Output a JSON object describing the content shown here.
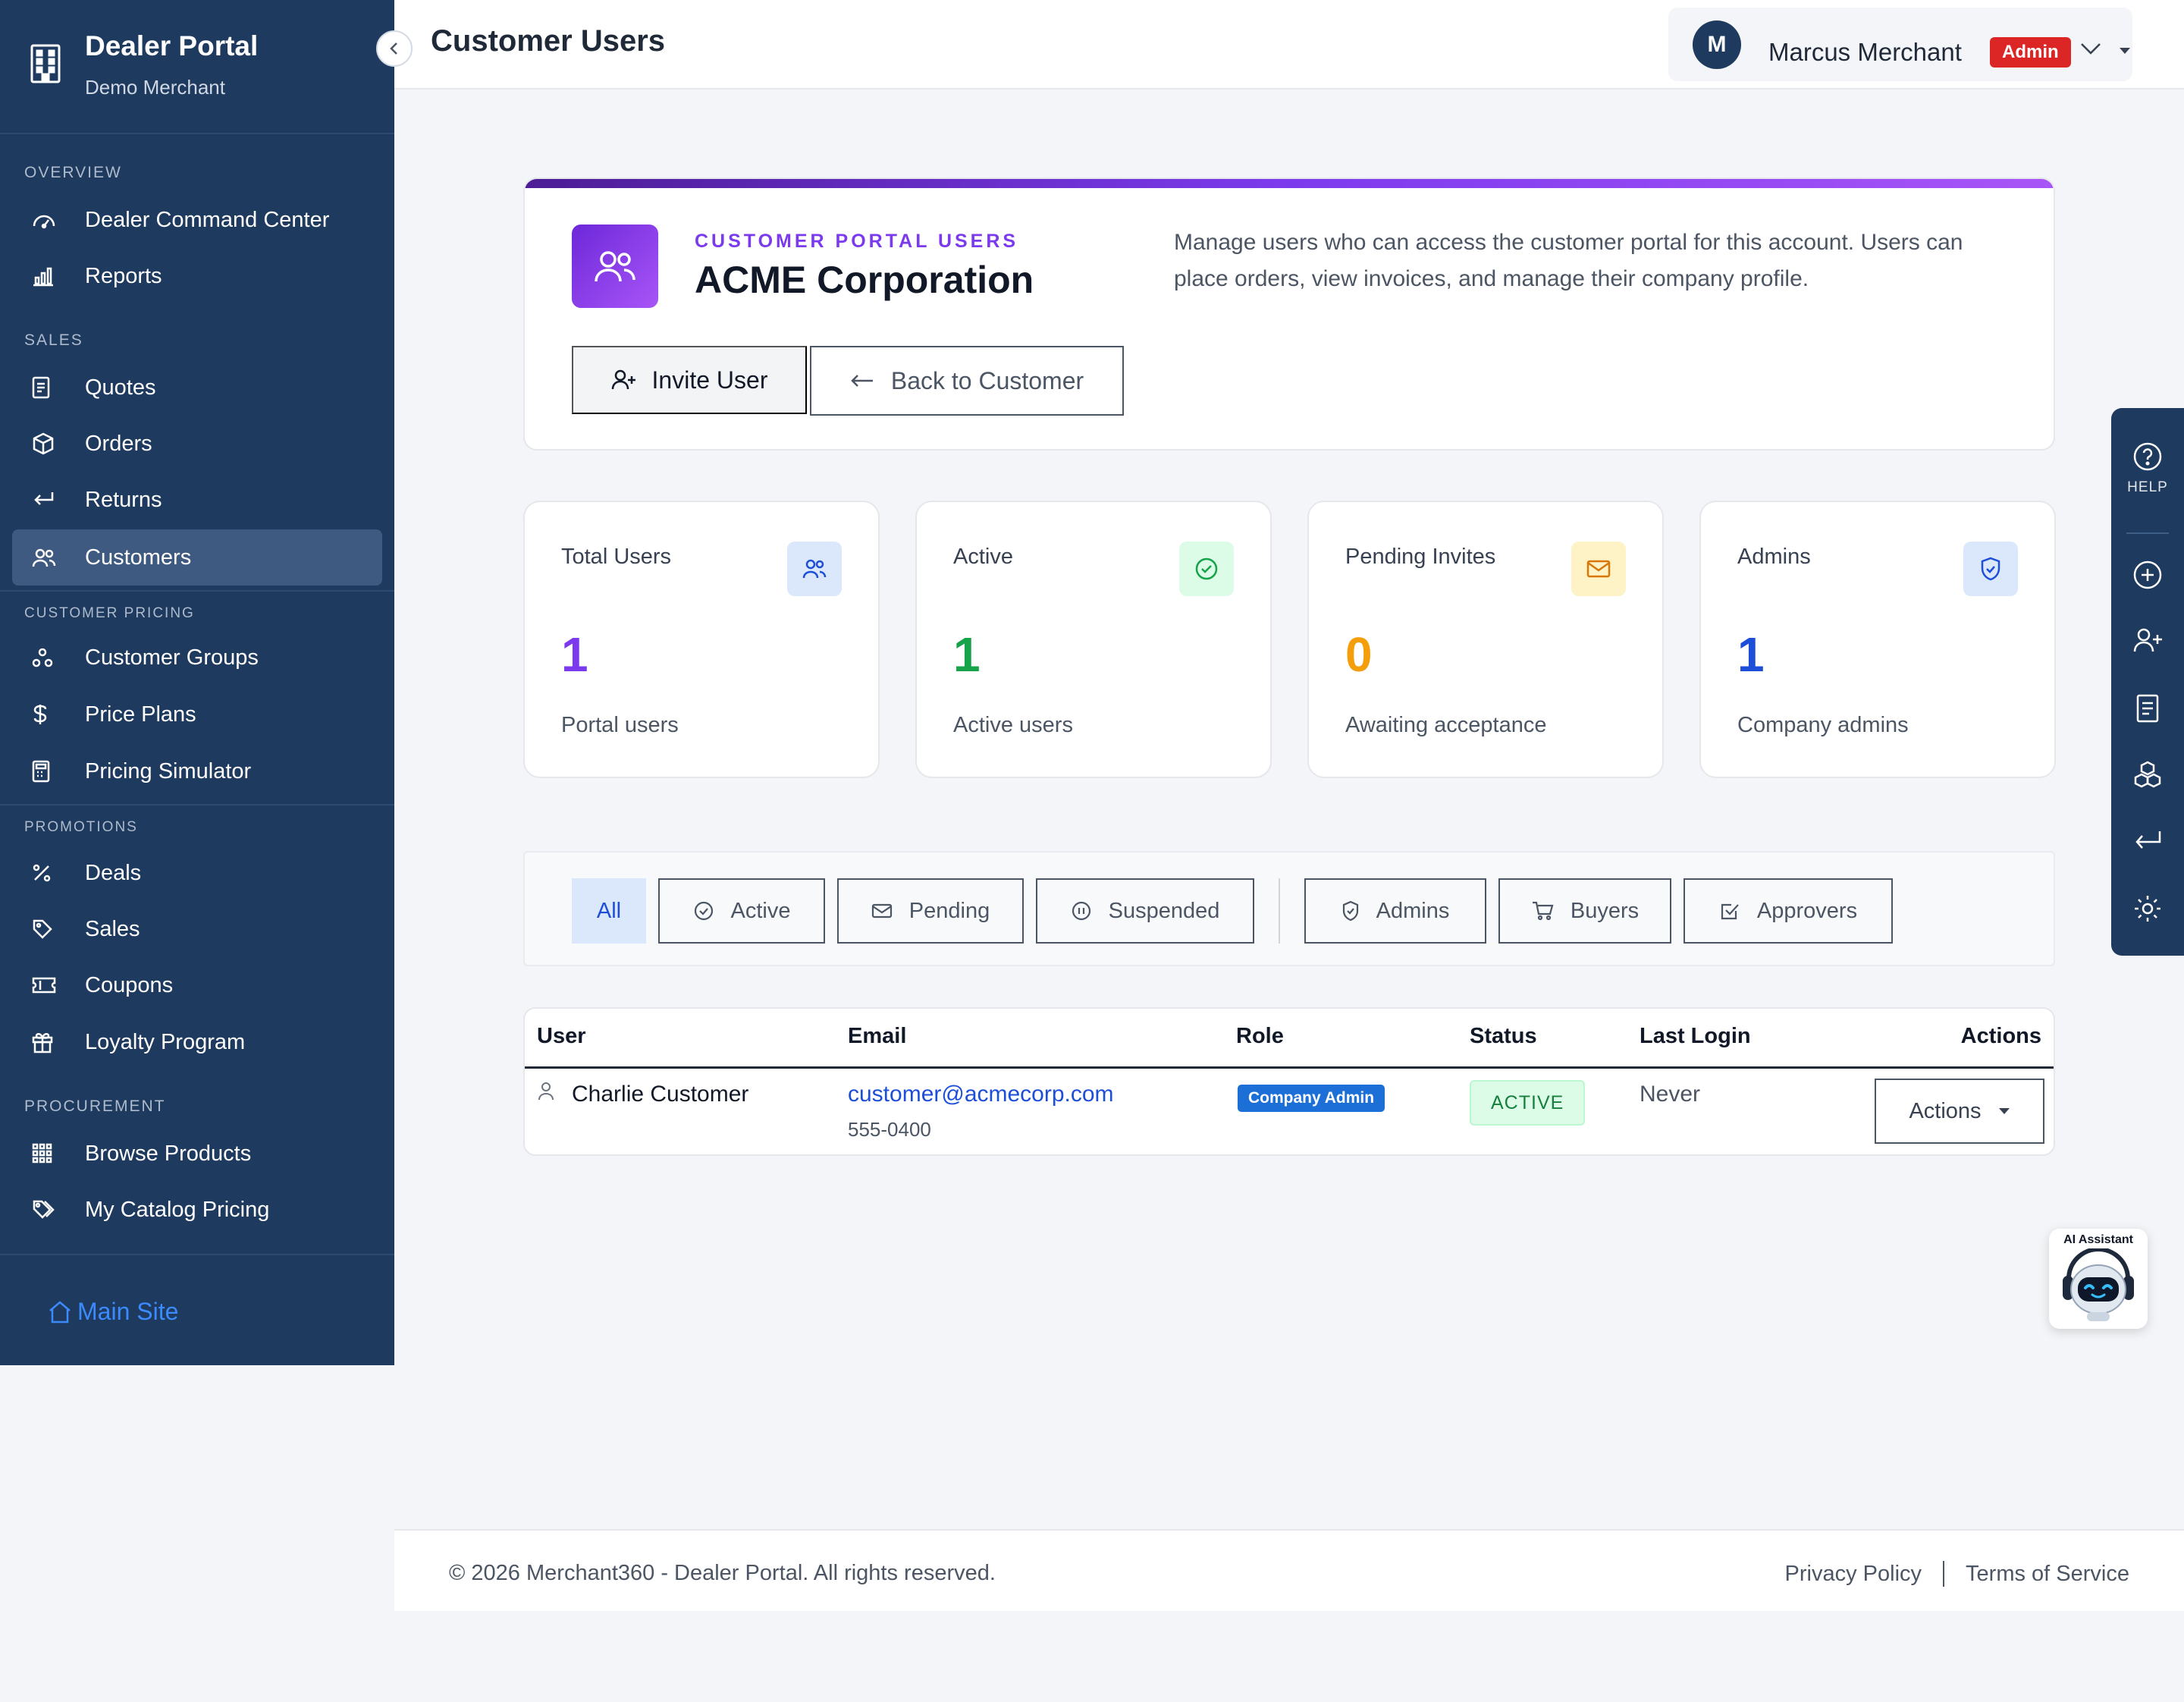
{
  "sidebar": {
    "brand_title": "Dealer Portal",
    "brand_subtitle": "Demo Merchant",
    "sections": {
      "overview": "OVERVIEW",
      "sales": "SALES",
      "customer_pricing": "CUSTOMER PRICING",
      "promotions": "PROMOTIONS",
      "procurement": "PROCUREMENT"
    },
    "items": {
      "command_center": "Dealer Command Center",
      "reports": "Reports",
      "quotes": "Quotes",
      "orders": "Orders",
      "returns": "Returns",
      "customers": "Customers",
      "customer_groups": "Customer Groups",
      "price_plans": "Price Plans",
      "pricing_simulator": "Pricing Simulator",
      "deals": "Deals",
      "sales": "Sales",
      "coupons": "Coupons",
      "loyalty": "Loyalty Program",
      "browse_products": "Browse Products",
      "catalog_pricing": "My Catalog Pricing"
    },
    "active_item": "Customers",
    "main_site": "Main Site"
  },
  "header": {
    "title": "Customer Users",
    "user_initial": "M",
    "user_name": "Marcus Merchant",
    "user_role": "Admin"
  },
  "hero": {
    "eyebrow": "CUSTOMER PORTAL USERS",
    "title": "ACME Corporation",
    "description": "Manage users who can access the customer portal for this account. Users can place orders, view invoices, and manage their company profile.",
    "invite_label": "Invite User",
    "back_label": "Back to Customer"
  },
  "stats": [
    {
      "label": "Total Users",
      "value": "1",
      "sub": "Portal users",
      "color": "#7c3aed",
      "icon": "users-icon"
    },
    {
      "label": "Active",
      "value": "1",
      "sub": "Active users",
      "color": "#16a34a",
      "icon": "check-circle-icon"
    },
    {
      "label": "Pending Invites",
      "value": "0",
      "sub": "Awaiting acceptance",
      "color": "#f59e0b",
      "icon": "envelope-icon"
    },
    {
      "label": "Admins",
      "value": "1",
      "sub": "Company admins",
      "color": "#1d4ed8",
      "icon": "shield-icon"
    }
  ],
  "filters": {
    "all": "All",
    "active": "Active",
    "pending": "Pending",
    "suspended": "Suspended",
    "admins": "Admins",
    "buyers": "Buyers",
    "approvers": "Approvers",
    "selected": "All"
  },
  "table": {
    "headers": {
      "user": "User",
      "email": "Email",
      "role": "Role",
      "status": "Status",
      "last_login": "Last Login",
      "actions": "Actions"
    },
    "rows": [
      {
        "user": "Charlie Customer",
        "email": "customer@acmecorp.com",
        "phone": "555-0400",
        "role": "Company Admin",
        "status": "ACTIVE",
        "last_login": "Never",
        "actions_label": "Actions"
      }
    ]
  },
  "rail": {
    "help_label": "HELP"
  },
  "ai_assistant": {
    "label": "AI Assistant"
  },
  "footer": {
    "copyright": "© 2026 Merchant360 - Dealer Portal. All rights reserved.",
    "privacy": "Privacy Policy",
    "terms": "Terms of Service"
  },
  "colors": {
    "sidebar_bg": "#1e3a5f",
    "accent_purple": "#7c3aed",
    "admin_badge": "#dc2626",
    "link_blue": "#1d4ed8"
  }
}
